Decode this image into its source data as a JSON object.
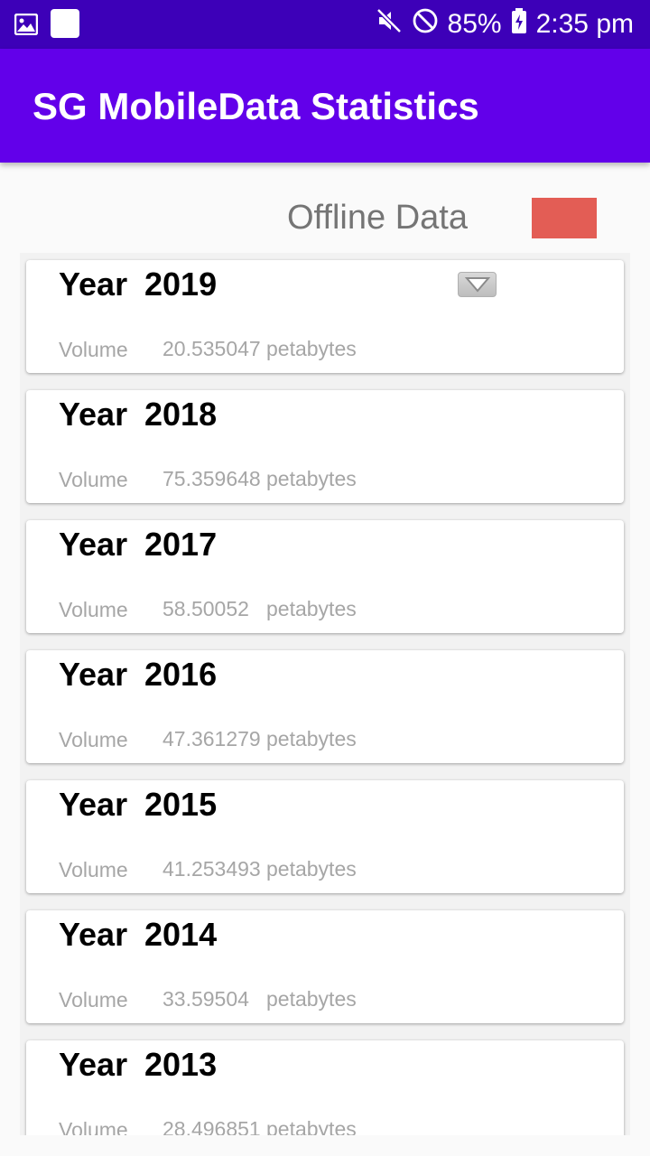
{
  "status_bar": {
    "battery": "85%",
    "time": "2:35 pm",
    "icons": [
      "image-icon",
      "notification-square-icon",
      "mute-icon",
      "do-not-disturb-icon",
      "battery-charging-icon"
    ]
  },
  "app_bar": {
    "title": "SG MobileData Statistics"
  },
  "offline": {
    "label": "Offline Data",
    "color": "#e35d55"
  },
  "list": {
    "year_label": "Year",
    "volume_label": "Volume",
    "items": [
      {
        "year": "2019",
        "volume": "20.535047",
        "unit": "petabytes",
        "has_dropdown": true
      },
      {
        "year": "2018",
        "volume": "75.359648",
        "unit": "petabytes"
      },
      {
        "year": "2017",
        "volume": "58.50052",
        "unit": "petabytes"
      },
      {
        "year": "2016",
        "volume": "47.361279",
        "unit": "petabytes"
      },
      {
        "year": "2015",
        "volume": "41.253493",
        "unit": "petabytes"
      },
      {
        "year": "2014",
        "volume": "33.59504",
        "unit": "petabytes"
      },
      {
        "year": "2013",
        "volume": "28.496851",
        "unit": "petabytes"
      }
    ]
  }
}
